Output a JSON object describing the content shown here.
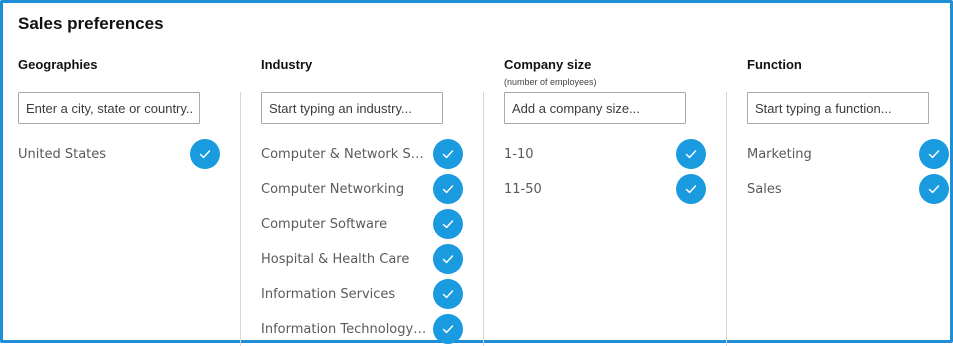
{
  "page": {
    "title": "Sales preferences"
  },
  "columns": [
    {
      "header": "Geographies",
      "sub": "",
      "placeholder": "Enter a city, state or country...",
      "items": [
        "United States"
      ]
    },
    {
      "header": "Industry",
      "sub": "",
      "placeholder": "Start typing an industry...",
      "items": [
        "Computer & Network Security",
        "Computer Networking",
        "Computer Software",
        "Hospital & Health Care",
        "Information Services",
        "Information Technology and Services"
      ]
    },
    {
      "header": "Company size",
      "sub": "(number of employees)",
      "placeholder": "Add a company size...",
      "items": [
        "1-10",
        "11-50"
      ]
    },
    {
      "header": "Function",
      "sub": "",
      "placeholder": "Start typing a function...",
      "items": [
        "Marketing",
        "Sales"
      ]
    }
  ],
  "colors": {
    "accent": "#1a9be0",
    "frame": "#1f8ed6",
    "divider": "#d6d6d6"
  },
  "icons": {
    "selected": "checkmark-icon"
  }
}
